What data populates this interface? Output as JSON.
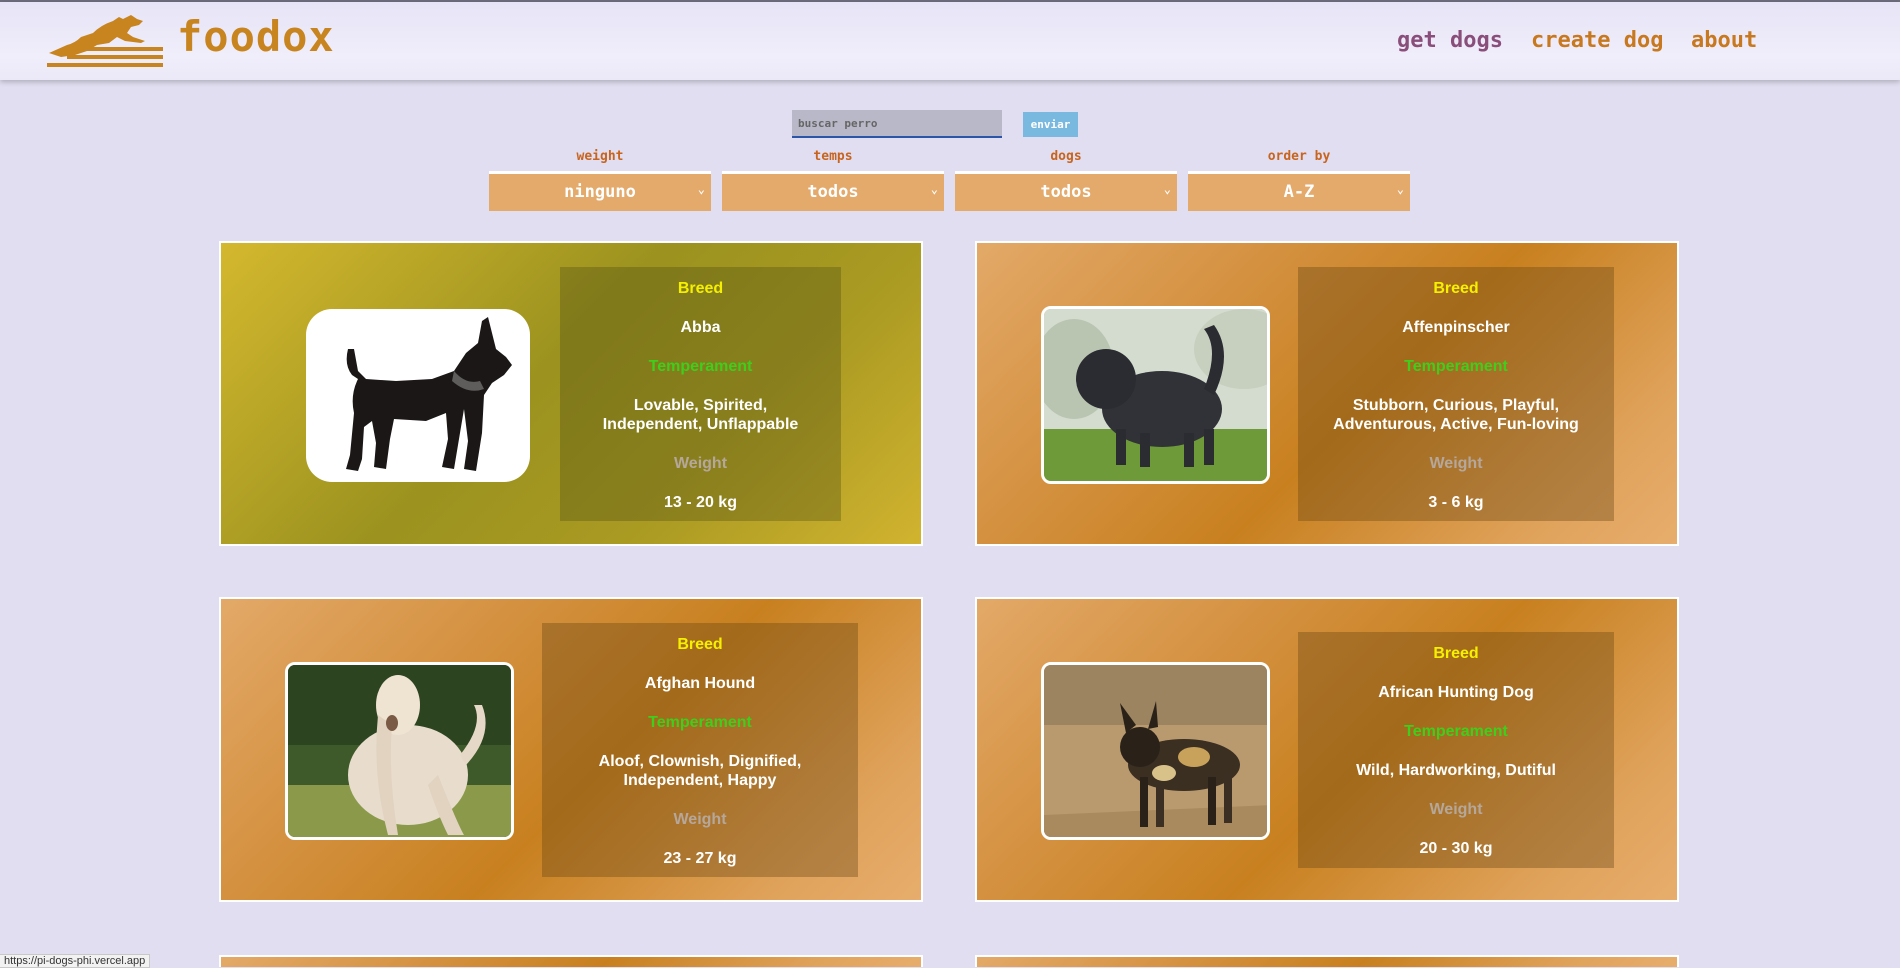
{
  "brand": {
    "name": "foodox"
  },
  "nav": {
    "get_dogs": "get dogs",
    "create_dog": "create dog",
    "about": "about"
  },
  "search": {
    "placeholder": "buscar perro",
    "button": "enviar"
  },
  "filters": [
    {
      "label": "weight",
      "value": "ninguno"
    },
    {
      "label": "temps",
      "value": "todos"
    },
    {
      "label": "dogs",
      "value": "todos"
    },
    {
      "label": "order by",
      "value": "A-Z"
    }
  ],
  "card_labels": {
    "breed": "Breed",
    "temperament": "Temperament",
    "weight": "Weight"
  },
  "dogs": [
    {
      "name": "Abba",
      "temperament": "Lovable, Spirited, Independent, Unflappable",
      "weight": "13 - 20 kg",
      "image": "dog-silhouette-icon"
    },
    {
      "name": "Affenpinscher",
      "temperament": "Stubborn, Curious, Playful, Adventurous, Active, Fun-loving",
      "weight": "3 - 6 kg",
      "image": "affenpinscher-photo"
    },
    {
      "name": "Afghan Hound",
      "temperament": "Aloof, Clownish, Dignified, Independent, Happy",
      "weight": "23 - 27 kg",
      "image": "afghan-hound-photo"
    },
    {
      "name": "African Hunting Dog",
      "temperament": "Wild, Hardworking, Dutiful",
      "weight": "20 - 30 kg",
      "image": "african-hunting-dog-photo"
    }
  ],
  "status_bar": {
    "url": "https://pi-dogs-phi.vercel.app"
  },
  "colors": {
    "background": "#e0def0",
    "brand": "#c8841e",
    "nav_active": "#8a4e7a",
    "breed_label": "#f5f000",
    "temperament_label": "#3fce1c",
    "weight_label": "#b5a79a"
  }
}
